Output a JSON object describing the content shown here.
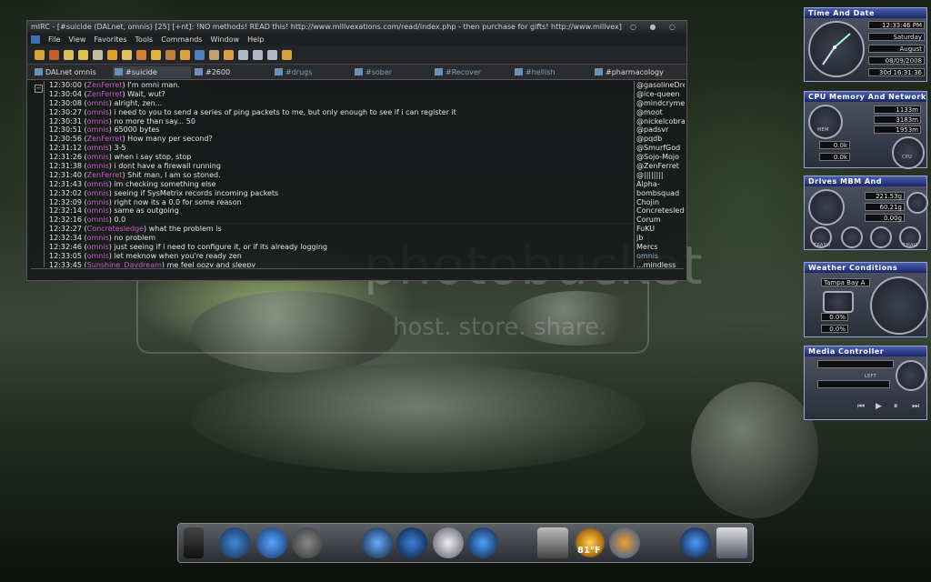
{
  "colors": {
    "accent": "#4b5fb0",
    "nick": "#c95cc9",
    "chat_bg": "#141618"
  },
  "watermark": {
    "text": "photobucket",
    "subtext": "host. store. share."
  },
  "mirc": {
    "title": "mIRC - [#suicide (DALnet, omnis) [25] [+nt]: !NO methods! READ this! http://www.millvexations.com/read/index.php - then purchase for gifts! http://www.millvex]",
    "window_buttons": "○ ● ○",
    "menu": [
      "File",
      "View",
      "Favorites",
      "Tools",
      "Commands",
      "Window",
      "Help"
    ],
    "tabs": [
      {
        "label": "DALnet omnis"
      },
      {
        "label": "#suicide"
      },
      {
        "label": "#2600"
      },
      {
        "label": "#drugs"
      },
      {
        "label": "#sober"
      },
      {
        "label": "#Recover"
      },
      {
        "label": "#hellish"
      },
      {
        "label": "#pharmacology"
      }
    ],
    "collapse_glyph": "−",
    "messages": [
      {
        "ts": "12:30:00",
        "nick": "ZenFerret",
        "text": "I'm omni man."
      },
      {
        "ts": "12:30:04",
        "nick": "ZenFerret",
        "text": "Wait, wut?"
      },
      {
        "ts": "12:30:08",
        "nick": "omnis",
        "text": "alright, zen..."
      },
      {
        "ts": "12:30:27",
        "nick": "omnis",
        "text": "i need to you to send a series of ping packets to me, but only enough to see if i can register it"
      },
      {
        "ts": "12:30:31",
        "nick": "omnis",
        "text": "no more than say... 50"
      },
      {
        "ts": "12:30:51",
        "nick": "omnis",
        "text": "65000 bytes"
      },
      {
        "ts": "12:30:56",
        "nick": "ZenFerret",
        "text": "How many per second?"
      },
      {
        "ts": "12:31:12",
        "nick": "omnis",
        "text": "3-5"
      },
      {
        "ts": "12:31:26",
        "nick": "omnis",
        "text": "when i say stop, stop"
      },
      {
        "ts": "12:31:38",
        "nick": "omnis",
        "text": "i dont have a firewall running"
      },
      {
        "ts": "12:31:40",
        "nick": "ZenFerret",
        "text": "Shit man, I am so stoned."
      },
      {
        "ts": "12:31:43",
        "nick": "omnis",
        "text": "im checking something else"
      },
      {
        "ts": "12:32:02",
        "nick": "omnis",
        "text": "seeing if SysMetrix records incoming packets"
      },
      {
        "ts": "12:32:09",
        "nick": "omnis",
        "text": "right now its a 0.0 for some reason"
      },
      {
        "ts": "12:32:14",
        "nick": "omnis",
        "text": "same as outgoing"
      },
      {
        "ts": "12:32:16",
        "nick": "omnis",
        "text": "0.0"
      },
      {
        "ts": "12:32:27",
        "nick": "Concretesledge",
        "text": "what the problem is"
      },
      {
        "ts": "12:32:34",
        "nick": "omnis",
        "text": "no problem"
      },
      {
        "ts": "12:32:46",
        "nick": "omnis",
        "text": "just seeing if i need to configure it, or if its already logging"
      },
      {
        "ts": "12:33:05",
        "nick": "omnis",
        "text": "let meknow when you're ready zen"
      },
      {
        "ts": "12:33:45",
        "nick": "Sunshine_Daydream",
        "text": "me feel oozy and sleepy"
      }
    ],
    "nicks": [
      "@gasolineDre",
      "@ice-queen",
      "@mindcryme",
      "@moot",
      "@nickelcobra",
      "@padsvr",
      "@pqdb",
      "@SmurfGod",
      "@Sojo-Mojo",
      "@ZenFerret",
      "@||||||||",
      "Alpha-",
      "bombsquad",
      "Chojin",
      "Concretesledg",
      "Corum",
      "FuKU",
      "jb",
      "Mercs",
      "omnis",
      "...mindless"
    ]
  },
  "widgets": {
    "time": {
      "title": "Time And Date",
      "time": "12:33:46 PM",
      "weekday": "Saturday",
      "month": "August",
      "date": "08/09/2008",
      "uptime": "30d 16:31:36"
    },
    "cpu": {
      "title": "CPU Memory And Network",
      "physical": "1133m",
      "swap": "3183m",
      "virtual": "1953m",
      "net_in": "0.0k",
      "net_out": "0.0k",
      "gauge_label": "CPU",
      "mem_label": "MEM"
    },
    "drives": {
      "title": "Drives MBM And Shortcuts",
      "total": "221.53g",
      "free": "60.21g",
      "third": "0.00g",
      "label1": "TRASH",
      "label2": "EMAIL"
    },
    "weather": {
      "title": "Weather Conditions",
      "location": "Tampa Bay A",
      "rh": "0.0%",
      "wind": "0.0%"
    },
    "media": {
      "title": "Media Controller",
      "left": "LEFT",
      "controls": [
        "⏮",
        "▶",
        "⏸",
        "⏭"
      ]
    }
  },
  "dock": {
    "temperature": "81°F"
  }
}
